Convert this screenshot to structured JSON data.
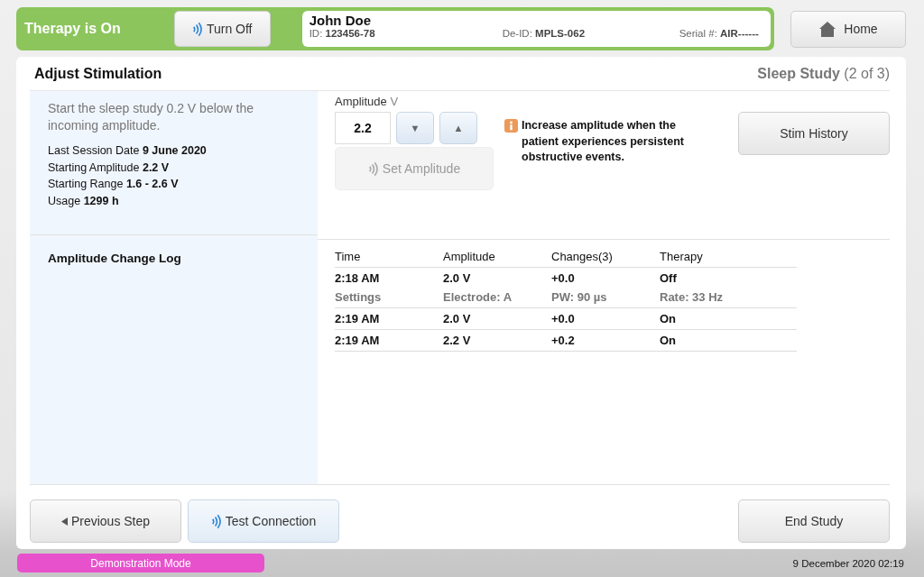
{
  "header": {
    "therapy_status": "Therapy is On",
    "therapy_on": true,
    "toggle_button": "Turn Off",
    "patient": {
      "name": "John Doe",
      "fields": [
        {
          "label": "ID:",
          "value": "123456-78"
        },
        {
          "label": "De-ID:",
          "value": "MPLS-062"
        },
        {
          "label": "Serial #:",
          "value": "AIR------"
        }
      ]
    },
    "home_button": "Home"
  },
  "panel": {
    "title": "Adjust Stimulation",
    "step_name": "Sleep Study",
    "step_count": "(2 of 3)",
    "instruction": "Start the sleep study 0.2 V below the incoming amplitude.",
    "facts": [
      {
        "label": "Last Session Date",
        "value": "9 June 2020"
      },
      {
        "label": "Starting Amplitude",
        "value": "2.2 V"
      },
      {
        "label": "Starting Range",
        "value": "1.6  -  2.6 V"
      },
      {
        "label": "Usage",
        "value": "1299 h"
      }
    ],
    "amplitude": {
      "label": "Amplitude",
      "unit": "V",
      "value": "2.2",
      "down": "▼",
      "up": "▲",
      "set_button": "Set Amplitude",
      "set_disabled": true
    },
    "info": "Increase amplitude when the patient experiences persistent obstructive events.",
    "history_button": "Stim History",
    "log": {
      "title": "Amplitude Change Log",
      "columns": [
        "Time",
        "Amplitude",
        "Changes(3)",
        "Therapy"
      ],
      "rows": [
        {
          "cells": [
            "2:18 AM",
            "2.0 V",
            "+0.0",
            "Off"
          ],
          "details": [
            "Settings",
            "Electrode: A",
            "PW: 90 µs",
            "Rate: 33 Hz"
          ]
        },
        {
          "cells": [
            "2:19 AM",
            "2.0 V",
            "+0.0",
            "On"
          ]
        },
        {
          "cells": [
            "2:19 AM",
            "2.2 V",
            "+0.2",
            "On"
          ]
        }
      ]
    },
    "previous_button": "Previous Step",
    "test_button": "Test Connection",
    "end_button": "End Study"
  },
  "status_bar": {
    "mode": "Demonstration Mode",
    "datetime": "9 December 2020 02:19"
  }
}
